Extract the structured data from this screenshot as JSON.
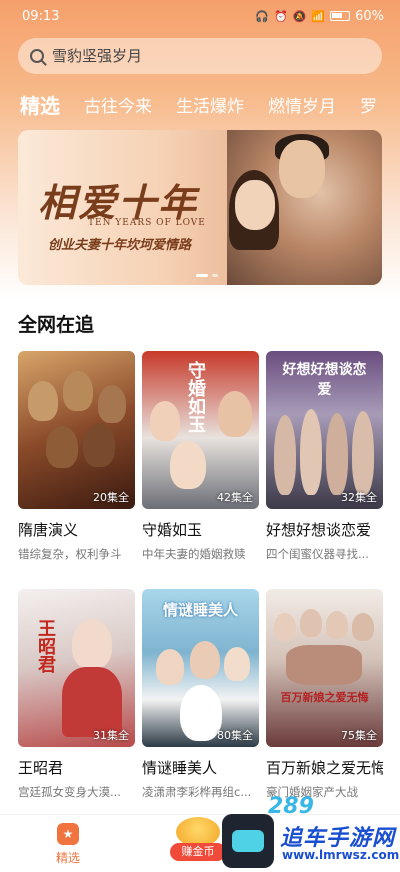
{
  "status_bar": {
    "time": "09:13",
    "battery": "60%",
    "icons": [
      "headphones-icon",
      "alarm-icon",
      "mute-icon",
      "wifi-icon",
      "signal-icon",
      "battery-icon"
    ]
  },
  "search": {
    "placeholder": "雪豹坚强岁月"
  },
  "tabs": [
    {
      "label": "精选",
      "active": true
    },
    {
      "label": "古往今来",
      "active": false
    },
    {
      "label": "生活爆炸",
      "active": false
    },
    {
      "label": "燃情岁月",
      "active": false
    },
    {
      "label": "罗",
      "active": false
    }
  ],
  "banner": {
    "title": "相爱十年",
    "title_en": "TEN YEARS OF LOVE",
    "subtitle": "创业夫妻十年坎坷爱情路",
    "page_count": 2,
    "current_page": 1
  },
  "section": {
    "title": "全网在追"
  },
  "shows": [
    {
      "title": "隋唐演义",
      "episodes": "20集全",
      "desc": "错综复杂，权利争斗"
    },
    {
      "title": "守婚如玉",
      "episodes": "42集全",
      "desc": "中年夫妻的婚姻救赎",
      "poster_text": "守婚如玉"
    },
    {
      "title": "好想好想谈恋爱",
      "episodes": "32集全",
      "desc": "四个闺蜜仪器寻找...",
      "poster_text": "好想好想谈恋爱"
    },
    {
      "title": "王昭君",
      "episodes": "31集全",
      "desc": "宫廷孤女变身大漠...",
      "poster_text": "王昭君"
    },
    {
      "title": "情谜睡美人",
      "episodes": "80集全",
      "desc": "凌潇肃李彩桦再组c...",
      "poster_text": "情谜睡美人"
    },
    {
      "title": "百万新娘之爱无悔",
      "episodes": "75集全",
      "desc": "豪门婚姻家产大战",
      "poster_text": "百万新娘之爱无悔"
    }
  ],
  "bottom_nav": {
    "home_label": "精选",
    "coin_label": "赚金币",
    "accent": "#f0743e"
  },
  "watermark": {
    "number": "289",
    "text": "追车手游网",
    "url": "www.lmrwsz.com"
  },
  "colors": {
    "accent": "#f0743e",
    "header_gradient_top": "#f5a06b"
  }
}
